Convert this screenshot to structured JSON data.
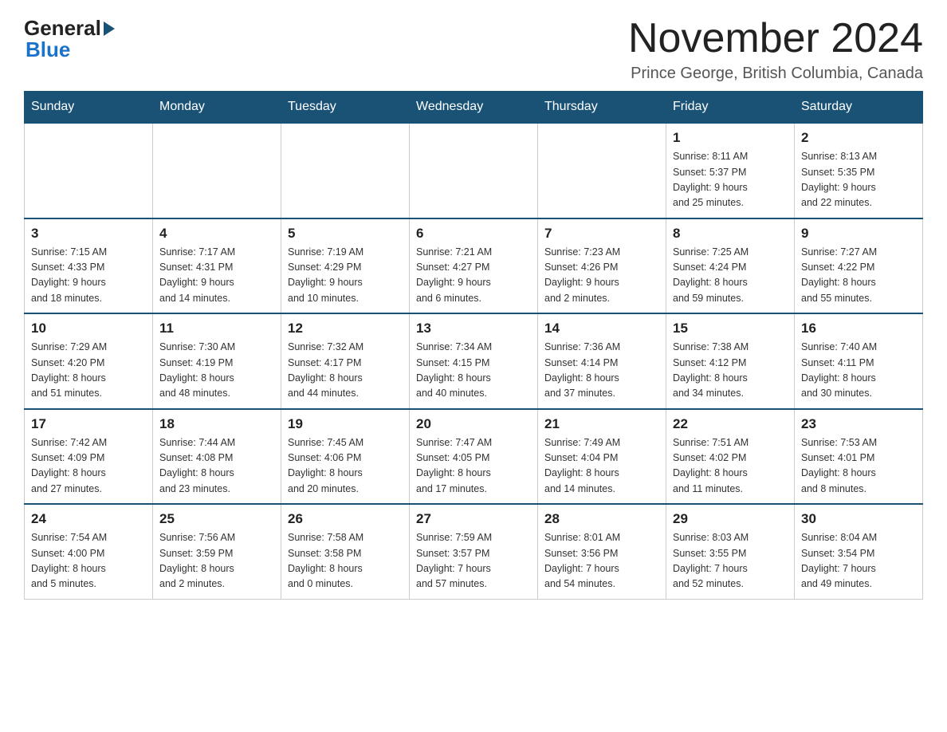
{
  "header": {
    "month_title": "November 2024",
    "location": "Prince George, British Columbia, Canada",
    "logo_general": "General",
    "logo_blue": "Blue"
  },
  "weekdays": [
    "Sunday",
    "Monday",
    "Tuesday",
    "Wednesday",
    "Thursday",
    "Friday",
    "Saturday"
  ],
  "weeks": [
    {
      "days": [
        {
          "number": "",
          "info": ""
        },
        {
          "number": "",
          "info": ""
        },
        {
          "number": "",
          "info": ""
        },
        {
          "number": "",
          "info": ""
        },
        {
          "number": "",
          "info": ""
        },
        {
          "number": "1",
          "info": "Sunrise: 8:11 AM\nSunset: 5:37 PM\nDaylight: 9 hours\nand 25 minutes."
        },
        {
          "number": "2",
          "info": "Sunrise: 8:13 AM\nSunset: 5:35 PM\nDaylight: 9 hours\nand 22 minutes."
        }
      ]
    },
    {
      "days": [
        {
          "number": "3",
          "info": "Sunrise: 7:15 AM\nSunset: 4:33 PM\nDaylight: 9 hours\nand 18 minutes."
        },
        {
          "number": "4",
          "info": "Sunrise: 7:17 AM\nSunset: 4:31 PM\nDaylight: 9 hours\nand 14 minutes."
        },
        {
          "number": "5",
          "info": "Sunrise: 7:19 AM\nSunset: 4:29 PM\nDaylight: 9 hours\nand 10 minutes."
        },
        {
          "number": "6",
          "info": "Sunrise: 7:21 AM\nSunset: 4:27 PM\nDaylight: 9 hours\nand 6 minutes."
        },
        {
          "number": "7",
          "info": "Sunrise: 7:23 AM\nSunset: 4:26 PM\nDaylight: 9 hours\nand 2 minutes."
        },
        {
          "number": "8",
          "info": "Sunrise: 7:25 AM\nSunset: 4:24 PM\nDaylight: 8 hours\nand 59 minutes."
        },
        {
          "number": "9",
          "info": "Sunrise: 7:27 AM\nSunset: 4:22 PM\nDaylight: 8 hours\nand 55 minutes."
        }
      ]
    },
    {
      "days": [
        {
          "number": "10",
          "info": "Sunrise: 7:29 AM\nSunset: 4:20 PM\nDaylight: 8 hours\nand 51 minutes."
        },
        {
          "number": "11",
          "info": "Sunrise: 7:30 AM\nSunset: 4:19 PM\nDaylight: 8 hours\nand 48 minutes."
        },
        {
          "number": "12",
          "info": "Sunrise: 7:32 AM\nSunset: 4:17 PM\nDaylight: 8 hours\nand 44 minutes."
        },
        {
          "number": "13",
          "info": "Sunrise: 7:34 AM\nSunset: 4:15 PM\nDaylight: 8 hours\nand 40 minutes."
        },
        {
          "number": "14",
          "info": "Sunrise: 7:36 AM\nSunset: 4:14 PM\nDaylight: 8 hours\nand 37 minutes."
        },
        {
          "number": "15",
          "info": "Sunrise: 7:38 AM\nSunset: 4:12 PM\nDaylight: 8 hours\nand 34 minutes."
        },
        {
          "number": "16",
          "info": "Sunrise: 7:40 AM\nSunset: 4:11 PM\nDaylight: 8 hours\nand 30 minutes."
        }
      ]
    },
    {
      "days": [
        {
          "number": "17",
          "info": "Sunrise: 7:42 AM\nSunset: 4:09 PM\nDaylight: 8 hours\nand 27 minutes."
        },
        {
          "number": "18",
          "info": "Sunrise: 7:44 AM\nSunset: 4:08 PM\nDaylight: 8 hours\nand 23 minutes."
        },
        {
          "number": "19",
          "info": "Sunrise: 7:45 AM\nSunset: 4:06 PM\nDaylight: 8 hours\nand 20 minutes."
        },
        {
          "number": "20",
          "info": "Sunrise: 7:47 AM\nSunset: 4:05 PM\nDaylight: 8 hours\nand 17 minutes."
        },
        {
          "number": "21",
          "info": "Sunrise: 7:49 AM\nSunset: 4:04 PM\nDaylight: 8 hours\nand 14 minutes."
        },
        {
          "number": "22",
          "info": "Sunrise: 7:51 AM\nSunset: 4:02 PM\nDaylight: 8 hours\nand 11 minutes."
        },
        {
          "number": "23",
          "info": "Sunrise: 7:53 AM\nSunset: 4:01 PM\nDaylight: 8 hours\nand 8 minutes."
        }
      ]
    },
    {
      "days": [
        {
          "number": "24",
          "info": "Sunrise: 7:54 AM\nSunset: 4:00 PM\nDaylight: 8 hours\nand 5 minutes."
        },
        {
          "number": "25",
          "info": "Sunrise: 7:56 AM\nSunset: 3:59 PM\nDaylight: 8 hours\nand 2 minutes."
        },
        {
          "number": "26",
          "info": "Sunrise: 7:58 AM\nSunset: 3:58 PM\nDaylight: 8 hours\nand 0 minutes."
        },
        {
          "number": "27",
          "info": "Sunrise: 7:59 AM\nSunset: 3:57 PM\nDaylight: 7 hours\nand 57 minutes."
        },
        {
          "number": "28",
          "info": "Sunrise: 8:01 AM\nSunset: 3:56 PM\nDaylight: 7 hours\nand 54 minutes."
        },
        {
          "number": "29",
          "info": "Sunrise: 8:03 AM\nSunset: 3:55 PM\nDaylight: 7 hours\nand 52 minutes."
        },
        {
          "number": "30",
          "info": "Sunrise: 8:04 AM\nSunset: 3:54 PM\nDaylight: 7 hours\nand 49 minutes."
        }
      ]
    }
  ]
}
